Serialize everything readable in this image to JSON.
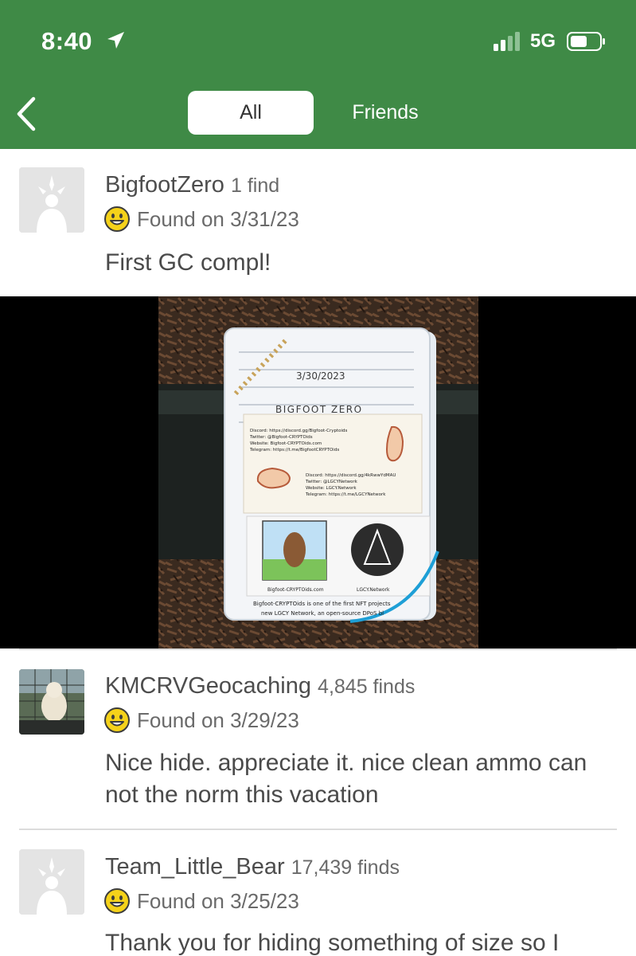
{
  "status_bar": {
    "time": "8:40",
    "network": "5G"
  },
  "nav": {
    "back_icon": "chevron-left-icon",
    "tabs": [
      {
        "label": "All",
        "selected": true
      },
      {
        "label": "Friends",
        "selected": false
      }
    ]
  },
  "logs": [
    {
      "username": "BigfootZero",
      "finds": "1 find",
      "found": "Found on 3/31/23",
      "text": "First GC compl!",
      "avatar": "default-avatar-icon"
    },
    {
      "username": "KMCRVGeocaching",
      "finds": "4,845 finds",
      "found": "Found on 3/29/23",
      "text": "Nice hide. appreciate it. nice clean ammo can not the norm this vacation",
      "avatar": "dog-photo-avatar"
    },
    {
      "username": "Team_Little_Bear",
      "finds": "17,439 finds",
      "found": "Found on 3/25/23",
      "text": "Thank you for hiding something of size so I",
      "avatar": "default-avatar-icon"
    }
  ],
  "photo": {
    "log_date": "3/30/2023",
    "signature": "BIGFOOT ZERO",
    "card_top_lines": [
      "Discord: https://discord.gg/Bigfoot-Cryptoids",
      "Twitter: @Bigfoot-CRYPTOids",
      "Website: Bigfoot-CRYPTOids.com",
      "Telegram: https://t.me/BigfootCRYPTOids"
    ],
    "card_bottom_lines": [
      "Discord: https://discord.gg/4kRwwYdMAU",
      "Twitter: @LGCYNetwork",
      "Website: LGCY.Network",
      "Telegram: https://t.me/LGCYNetwork"
    ],
    "sticker_left_caption": "Bigfoot-CRYPTOids.com",
    "sticker_right_caption": "LGCY.Network",
    "bottom_text_1": "Bigfoot-CRYPTOids is one of the first NFT projects",
    "bottom_text_2": "new LGCY Network, an open-source DPoS bl"
  },
  "colors": {
    "header_green": "#3f8a46",
    "smiley_yellow": "#f5d21a"
  }
}
